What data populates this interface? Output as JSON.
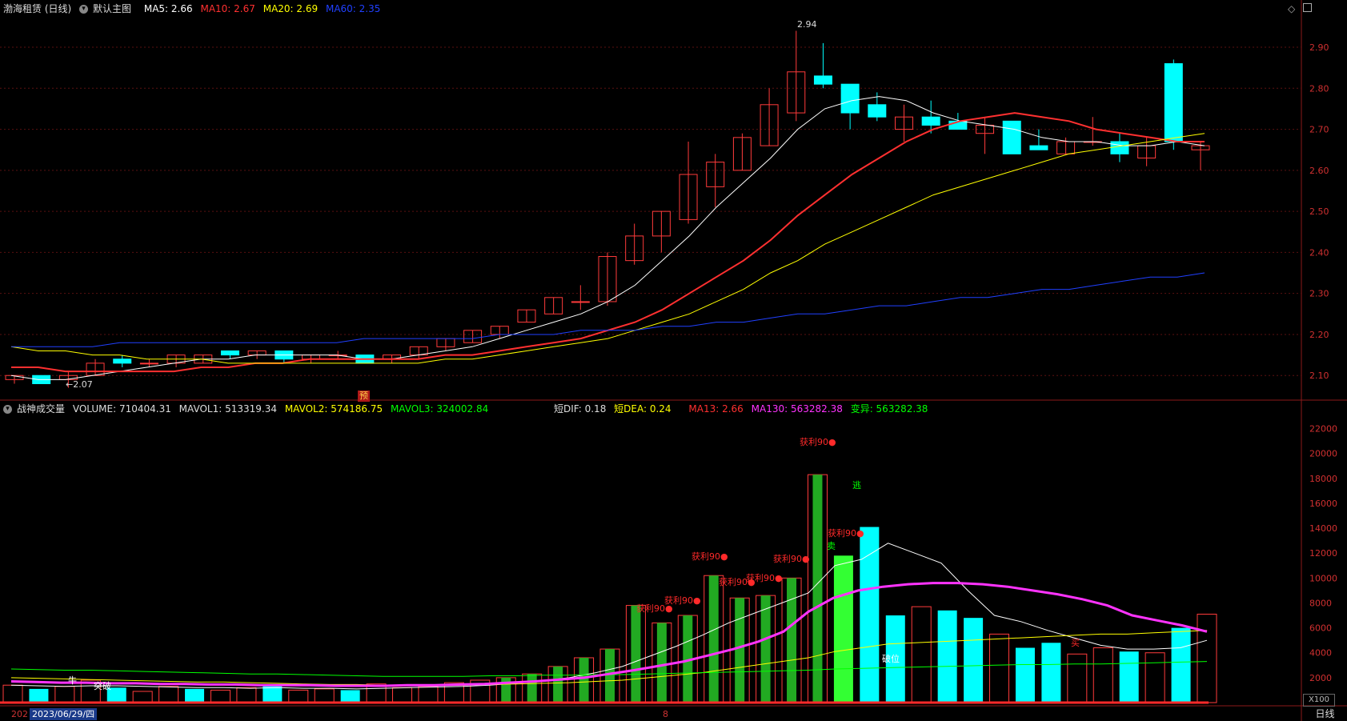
{
  "header_top": {
    "stock": "渤海租赁 (日线)",
    "main_chart_label": "默认主图",
    "ma5": {
      "label": "MA5: 2.66",
      "color": "#ffffff"
    },
    "ma10": {
      "label": "MA10: 2.67",
      "color": "#ff3030"
    },
    "ma20": {
      "label": "MA20: 2.69",
      "color": "#ffff00"
    },
    "ma60": {
      "label": "MA60: 2.35",
      "color": "#2040ff"
    }
  },
  "header_bottom": {
    "indicator": "战神成交量",
    "volume": {
      "label": "VOLUME: 710404.31",
      "color": "#dddddd"
    },
    "mavol1": {
      "label": "MAVOL1: 513319.34",
      "color": "#dddddd"
    },
    "mavol2": {
      "label": "MAVOL2: 574186.75",
      "color": "#ffff00"
    },
    "mavol3": {
      "label": "MAVOL3: 324002.84",
      "color": "#00ff00"
    },
    "dif": {
      "label": "短DIF: 0.18",
      "color": "#dddddd"
    },
    "dea": {
      "label": "短DEA: 0.24",
      "color": "#ffff00"
    },
    "ma13": {
      "label": "MA13: 2.66",
      "color": "#ff3030"
    },
    "ma130": {
      "label": "MA130: 563282.38",
      "color": "#ff33ff"
    },
    "bianyi": {
      "label": "变异: 563282.38",
      "color": "#00ff00"
    }
  },
  "footer": {
    "date_prefix": "202",
    "date": "2023/06/29/四",
    "month_tick": "8",
    "zoom": "X100",
    "period_tab": "日线"
  },
  "annotations": {
    "high": "2.94",
    "low": "←2.07",
    "yu": "预",
    "tupo": "突破",
    "niu": "牛",
    "huoli": "获利90●",
    "taoli": "逃",
    "poweil": "破位",
    "mai": "卖",
    "mai2": "买"
  },
  "chart_data": [
    {
      "type": "candlestick",
      "title": "渤海租赁 (日线)",
      "ylim": [
        2.04,
        2.98
      ],
      "y_ticks": [
        2.1,
        2.2,
        2.3,
        2.4,
        2.5,
        2.6,
        2.7,
        2.8,
        2.9
      ],
      "y_tick_labels": [
        "2.10",
        "2.20",
        "2.30",
        "2.40",
        "2.50",
        "2.60",
        "2.70",
        "2.80",
        "2.90"
      ],
      "candles": [
        {
          "o": 2.09,
          "h": 2.1,
          "l": 2.08,
          "c": 2.1
        },
        {
          "o": 2.1,
          "h": 2.1,
          "l": 2.08,
          "c": 2.08
        },
        {
          "o": 2.09,
          "h": 2.11,
          "l": 2.07,
          "c": 2.1
        },
        {
          "o": 2.1,
          "h": 2.14,
          "l": 2.1,
          "c": 2.13
        },
        {
          "o": 2.14,
          "h": 2.15,
          "l": 2.12,
          "c": 2.13
        },
        {
          "o": 2.13,
          "h": 2.14,
          "l": 2.12,
          "c": 2.13
        },
        {
          "o": 2.13,
          "h": 2.15,
          "l": 2.12,
          "c": 2.15
        },
        {
          "o": 2.13,
          "h": 2.15,
          "l": 2.13,
          "c": 2.15
        },
        {
          "o": 2.16,
          "h": 2.16,
          "l": 2.14,
          "c": 2.15
        },
        {
          "o": 2.15,
          "h": 2.16,
          "l": 2.14,
          "c": 2.16
        },
        {
          "o": 2.16,
          "h": 2.16,
          "l": 2.13,
          "c": 2.14
        },
        {
          "o": 2.14,
          "h": 2.15,
          "l": 2.13,
          "c": 2.15
        },
        {
          "o": 2.15,
          "h": 2.16,
          "l": 2.14,
          "c": 2.15
        },
        {
          "o": 2.15,
          "h": 2.15,
          "l": 2.13,
          "c": 2.13
        },
        {
          "o": 2.14,
          "h": 2.15,
          "l": 2.13,
          "c": 2.15
        },
        {
          "o": 2.15,
          "h": 2.17,
          "l": 2.14,
          "c": 2.17
        },
        {
          "o": 2.17,
          "h": 2.19,
          "l": 2.16,
          "c": 2.19
        },
        {
          "o": 2.18,
          "h": 2.21,
          "l": 2.18,
          "c": 2.21
        },
        {
          "o": 2.2,
          "h": 2.22,
          "l": 2.19,
          "c": 2.22
        },
        {
          "o": 2.23,
          "h": 2.26,
          "l": 2.23,
          "c": 2.26
        },
        {
          "o": 2.25,
          "h": 2.29,
          "l": 2.25,
          "c": 2.29
        },
        {
          "o": 2.28,
          "h": 2.32,
          "l": 2.26,
          "c": 2.28
        },
        {
          "o": 2.28,
          "h": 2.4,
          "l": 2.27,
          "c": 2.39
        },
        {
          "o": 2.38,
          "h": 2.47,
          "l": 2.37,
          "c": 2.44
        },
        {
          "o": 2.44,
          "h": 2.5,
          "l": 2.4,
          "c": 2.5
        },
        {
          "o": 2.48,
          "h": 2.67,
          "l": 2.47,
          "c": 2.59
        },
        {
          "o": 2.56,
          "h": 2.64,
          "l": 2.51,
          "c": 2.62
        },
        {
          "o": 2.6,
          "h": 2.69,
          "l": 2.6,
          "c": 2.68
        },
        {
          "o": 2.66,
          "h": 2.8,
          "l": 2.66,
          "c": 2.76
        },
        {
          "o": 2.74,
          "h": 2.94,
          "l": 2.72,
          "c": 2.84
        },
        {
          "o": 2.83,
          "h": 2.91,
          "l": 2.8,
          "c": 2.81
        },
        {
          "o": 2.81,
          "h": 2.81,
          "l": 2.7,
          "c": 2.74
        },
        {
          "o": 2.76,
          "h": 2.79,
          "l": 2.72,
          "c": 2.73
        },
        {
          "o": 2.7,
          "h": 2.76,
          "l": 2.67,
          "c": 2.73
        },
        {
          "o": 2.73,
          "h": 2.77,
          "l": 2.69,
          "c": 2.71
        },
        {
          "o": 2.72,
          "h": 2.74,
          "l": 2.7,
          "c": 2.7
        },
        {
          "o": 2.69,
          "h": 2.73,
          "l": 2.64,
          "c": 2.71
        },
        {
          "o": 2.72,
          "h": 2.72,
          "l": 2.64,
          "c": 2.64
        },
        {
          "o": 2.66,
          "h": 2.7,
          "l": 2.65,
          "c": 2.65
        },
        {
          "o": 2.64,
          "h": 2.68,
          "l": 2.64,
          "c": 2.67
        },
        {
          "o": 2.67,
          "h": 2.73,
          "l": 2.66,
          "c": 2.67
        },
        {
          "o": 2.67,
          "h": 2.69,
          "l": 2.62,
          "c": 2.64
        },
        {
          "o": 2.63,
          "h": 2.68,
          "l": 2.61,
          "c": 2.66
        },
        {
          "o": 2.86,
          "h": 2.87,
          "l": 2.65,
          "c": 2.67
        },
        {
          "o": 2.65,
          "h": 2.67,
          "l": 2.6,
          "c": 2.66
        }
      ],
      "series": [
        {
          "name": "MA5",
          "color": "#ffffff",
          "values": [
            2.1,
            2.09,
            2.09,
            2.1,
            2.11,
            2.12,
            2.13,
            2.14,
            2.14,
            2.15,
            2.15,
            2.15,
            2.15,
            2.14,
            2.14,
            2.15,
            2.16,
            2.17,
            2.19,
            2.21,
            2.23,
            2.25,
            2.28,
            2.32,
            2.38,
            2.44,
            2.51,
            2.57,
            2.63,
            2.7,
            2.75,
            2.77,
            2.78,
            2.77,
            2.74,
            2.72,
            2.71,
            2.7,
            2.68,
            2.67,
            2.67,
            2.66,
            2.66,
            2.67,
            2.66
          ]
        },
        {
          "name": "MA10",
          "color": "#ff3030",
          "values": [
            2.12,
            2.12,
            2.11,
            2.11,
            2.11,
            2.11,
            2.11,
            2.12,
            2.12,
            2.13,
            2.13,
            2.14,
            2.14,
            2.14,
            2.14,
            2.14,
            2.15,
            2.15,
            2.16,
            2.17,
            2.18,
            2.19,
            2.21,
            2.23,
            2.26,
            2.3,
            2.34,
            2.38,
            2.43,
            2.49,
            2.54,
            2.59,
            2.63,
            2.67,
            2.7,
            2.72,
            2.73,
            2.74,
            2.73,
            2.72,
            2.7,
            2.69,
            2.68,
            2.67,
            2.67
          ]
        },
        {
          "name": "MA20",
          "color": "#ffff00",
          "values": [
            2.17,
            2.16,
            2.16,
            2.15,
            2.15,
            2.14,
            2.14,
            2.14,
            2.13,
            2.13,
            2.13,
            2.13,
            2.13,
            2.13,
            2.13,
            2.13,
            2.14,
            2.14,
            2.15,
            2.16,
            2.17,
            2.18,
            2.19,
            2.21,
            2.23,
            2.25,
            2.28,
            2.31,
            2.35,
            2.38,
            2.42,
            2.45,
            2.48,
            2.51,
            2.54,
            2.56,
            2.58,
            2.6,
            2.62,
            2.64,
            2.65,
            2.66,
            2.67,
            2.68,
            2.69
          ]
        },
        {
          "name": "MA60",
          "color": "#2040ff",
          "values": [
            2.17,
            2.17,
            2.17,
            2.17,
            2.18,
            2.18,
            2.18,
            2.18,
            2.18,
            2.18,
            2.18,
            2.18,
            2.18,
            2.19,
            2.19,
            2.19,
            2.19,
            2.19,
            2.2,
            2.2,
            2.2,
            2.21,
            2.21,
            2.21,
            2.22,
            2.22,
            2.23,
            2.23,
            2.24,
            2.25,
            2.25,
            2.26,
            2.27,
            2.27,
            2.28,
            2.29,
            2.29,
            2.3,
            2.31,
            2.31,
            2.32,
            2.33,
            2.34,
            2.34,
            2.35
          ]
        }
      ]
    },
    {
      "type": "bar",
      "title": "战神成交量",
      "ylim": [
        0,
        23000
      ],
      "y_ticks": [
        2000,
        4000,
        6000,
        8000,
        10000,
        12000,
        14000,
        16000,
        18000,
        20000,
        22000
      ],
      "y_tick_labels": [
        "2000",
        "4000",
        "6000",
        "8000",
        "10000",
        "12000",
        "14000",
        "16000",
        "18000",
        "20000",
        "22000"
      ],
      "volume": [
        1400,
        1100,
        1300,
        1800,
        1200,
        900,
        1300,
        1100,
        1000,
        1200,
        1400,
        1000,
        1100,
        1000,
        1500,
        1200,
        1300,
        1600,
        1800,
        2000,
        2300,
        2900,
        3600,
        4300,
        7800,
        6400,
        7000,
        10200,
        8400,
        8600,
        10000,
        18300,
        11800,
        14100,
        7000,
        7700,
        7400,
        6800,
        5500,
        4400,
        4800,
        3900,
        4400,
        4100,
        4000,
        6000,
        7100
      ],
      "colors": [
        "red",
        "cyan",
        "red",
        "red",
        "cyan",
        "red",
        "red",
        "cyan",
        "red",
        "red",
        "cyan",
        "red",
        "red",
        "cyan",
        "red",
        "red",
        "red",
        "red",
        "red",
        "green",
        "green",
        "green",
        "green",
        "green",
        "green",
        "green",
        "green",
        "green",
        "green",
        "green",
        "green",
        "green",
        "lime",
        "cyan",
        "cyan",
        "red",
        "cyan",
        "cyan",
        "red",
        "cyan",
        "cyan",
        "red",
        "red",
        "cyan",
        "red",
        "cyan",
        "red"
      ],
      "series": [
        {
          "name": "MAVOL1",
          "color": "#ffffff",
          "values": [
            1400,
            1350,
            1300,
            1350,
            1350,
            1300,
            1250,
            1200,
            1200,
            1150,
            1200,
            1150,
            1150,
            1100,
            1150,
            1200,
            1250,
            1300,
            1400,
            1550,
            1750,
            2000,
            2400,
            2900,
            3700,
            4500,
            5400,
            6400,
            7200,
            8000,
            8800,
            11000,
            11500,
            12800,
            12000,
            11200,
            9000,
            7000,
            6500,
            5800,
            5200,
            4600,
            4300,
            4300,
            4400,
            5000
          ]
        },
        {
          "name": "MAVOL2",
          "color": "#ffff00",
          "values": [
            2000,
            1950,
            1900,
            1850,
            1800,
            1750,
            1700,
            1650,
            1650,
            1600,
            1550,
            1500,
            1450,
            1450,
            1400,
            1400,
            1400,
            1400,
            1450,
            1500,
            1550,
            1600,
            1700,
            1800,
            2000,
            2200,
            2400,
            2700,
            3000,
            3300,
            3600,
            4100,
            4400,
            4700,
            4800,
            4900,
            5000,
            5100,
            5200,
            5300,
            5400,
            5500,
            5500,
            5600,
            5700,
            5800
          ]
        },
        {
          "name": "MAVOL3",
          "color": "#00ff00",
          "values": [
            2700,
            2650,
            2600,
            2600,
            2550,
            2500,
            2450,
            2400,
            2350,
            2300,
            2300,
            2250,
            2200,
            2150,
            2100,
            2100,
            2100,
            2100,
            2150,
            2150,
            2200,
            2200,
            2250,
            2250,
            2300,
            2350,
            2400,
            2450,
            2500,
            2550,
            2600,
            2700,
            2750,
            2800,
            2850,
            2900,
            2950,
            3000,
            3050,
            3050,
            3100,
            3100,
            3150,
            3200,
            3250,
            3300
          ]
        },
        {
          "name": "MA130",
          "color": "#ff33ff",
          "values": [
            1700,
            1650,
            1600,
            1600,
            1550,
            1550,
            1500,
            1500,
            1450,
            1450,
            1400,
            1400,
            1400,
            1350,
            1350,
            1350,
            1400,
            1400,
            1450,
            1500,
            1600,
            1700,
            1850,
            2000,
            2300,
            2600,
            2950,
            3300,
            3800,
            4300,
            4900,
            5700,
            7300,
            8400,
            9000,
            9300,
            9500,
            9600,
            9600,
            9500,
            9300,
            9000,
            8700,
            8300,
            7800,
            7000,
            6600,
            6200,
            5700
          ]
        }
      ]
    }
  ]
}
